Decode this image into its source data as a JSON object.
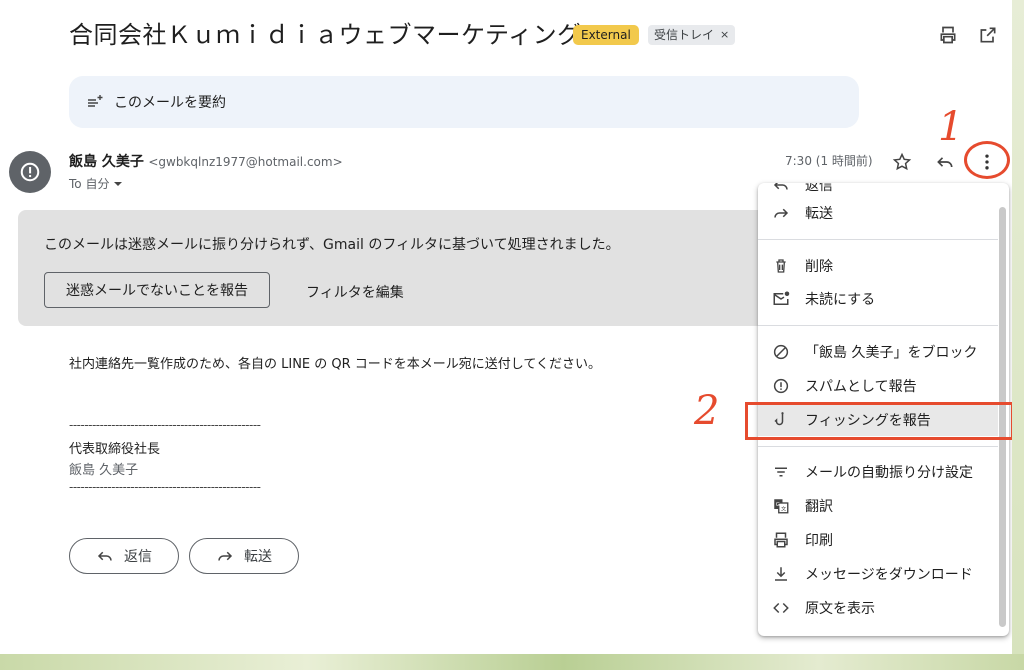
{
  "email": {
    "subject": "合同会社Ｋｕｍｉｄｉａウェブマーケティング",
    "badge_external": "External",
    "badge_inbox": "受信トレイ",
    "badge_inbox_close": "×",
    "summarize_label": "このメールを要約",
    "sender_name": "飯島 久美子",
    "sender_email": "<gwbkqlnz1977@hotmail.com>",
    "to_label": "To 自分",
    "time": "7:30 (1 時間前)"
  },
  "spam_notice": {
    "message": "このメールは迷惑メールに振り分けられず、Gmail のフィルタに基づいて処理されました。",
    "report_button": "迷惑メールでないことを報告",
    "edit_filter": "フィルタを編集"
  },
  "body": {
    "text": "社内連絡先一覧作成のため、各自の LINE の QR コードを本メール宛に送付してください。",
    "divider": "--------------------------------------------------",
    "signature_title": "代表取締役社長",
    "signature_name": "飯島 久美子"
  },
  "actions": {
    "reply": "返信",
    "forward": "転送"
  },
  "menu": {
    "items": [
      {
        "label": "返信",
        "icon": "reply-icon"
      },
      {
        "label": "転送",
        "icon": "forward-icon"
      },
      {
        "label": "削除",
        "icon": "trash-icon"
      },
      {
        "label": "未読にする",
        "icon": "mark-unread-icon"
      },
      {
        "label": "「飯島 久美子」をブロック",
        "icon": "block-icon"
      },
      {
        "label": "スパムとして報告",
        "icon": "report-spam-icon"
      },
      {
        "label": "フィッシングを報告",
        "icon": "phishing-hook-icon"
      },
      {
        "label": "メールの自動振り分け設定",
        "icon": "filter-icon"
      },
      {
        "label": "翻訳",
        "icon": "translate-icon"
      },
      {
        "label": "印刷",
        "icon": "print-icon"
      },
      {
        "label": "メッセージをダウンロード",
        "icon": "download-icon"
      },
      {
        "label": "原文を表示",
        "icon": "code-icon"
      }
    ]
  },
  "annotations": {
    "step1": "1",
    "step2": "2",
    "color": "#e64b2e"
  },
  "colors": {
    "external_badge": "#f2c94c",
    "summary_bg": "#eef3fa",
    "spam_box_bg": "#e1e1e1"
  }
}
